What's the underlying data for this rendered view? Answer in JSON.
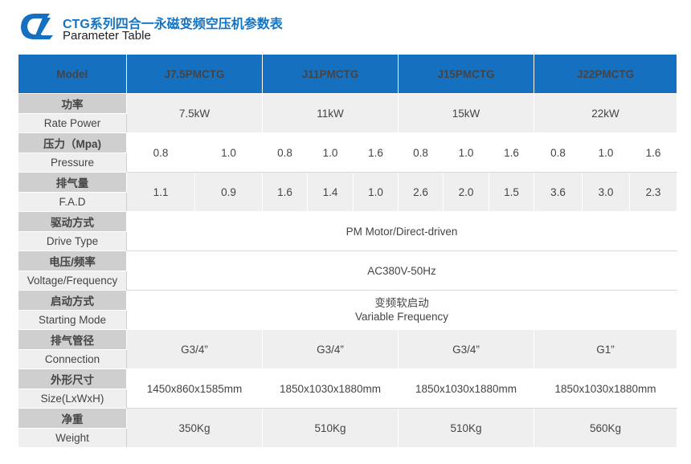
{
  "header": {
    "logo_icon": "ctg-logo-icon",
    "title_cn": "CTG系列四合一永磁变频空压机参数表",
    "title_en": "Parameter Table"
  },
  "colors": {
    "accent": "#1670c0",
    "label_text": "#1474c4",
    "label_bg": "#cfcfcf",
    "row_bg": "#efefef"
  },
  "table": {
    "model_label": "Model",
    "models": [
      "J7.5PMCTG",
      "J11PMCTG",
      "J15PMCTG",
      "J22PMCTG"
    ],
    "rows": {
      "power": {
        "cn": "功率",
        "en": "Rate Power",
        "values": [
          "7.5kW",
          "11kW",
          "15kW",
          "22kW"
        ]
      },
      "pressure": {
        "cn": "压力（Mpa)",
        "en": "Pressure",
        "values": [
          "0.8",
          "1.0",
          "0.8",
          "1.0",
          "1.6",
          "0.8",
          "1.0",
          "1.6",
          "0.8",
          "1.0",
          "1.6"
        ]
      },
      "fad": {
        "cn": "排气量",
        "en": "F.A.D",
        "values": [
          "1.1",
          "0.9",
          "1.6",
          "1.4",
          "1.0",
          "2.6",
          "2.0",
          "1.5",
          "3.6",
          "3.0",
          "2.3"
        ]
      },
      "drive": {
        "cn": "驱动方式",
        "en": "Drive Type",
        "value": "PM Motor/Direct-driven"
      },
      "voltage": {
        "cn": "电压/频率",
        "en": "Voltage/Frequency",
        "value": "AC380V-50Hz"
      },
      "starting": {
        "cn": "启动方式",
        "en": "Starting Mode",
        "value_cn": "变频软启动",
        "value_en": "Variable Frequency"
      },
      "connection": {
        "cn": "排气管径",
        "en": "Connection",
        "values": [
          "G3/4”",
          "G3/4”",
          "G3/4”",
          "G1”"
        ]
      },
      "size": {
        "cn": "外形尺寸",
        "en": "Size(LxWxH)",
        "values": [
          "1450x860x1585mm",
          "1850x1030x1880mm",
          "1850x1030x1880mm",
          "1850x1030x1880mm"
        ]
      },
      "weight": {
        "cn": "净重",
        "en": "Weight",
        "values": [
          "350Kg",
          "510Kg",
          "510Kg",
          "560Kg"
        ]
      }
    }
  }
}
